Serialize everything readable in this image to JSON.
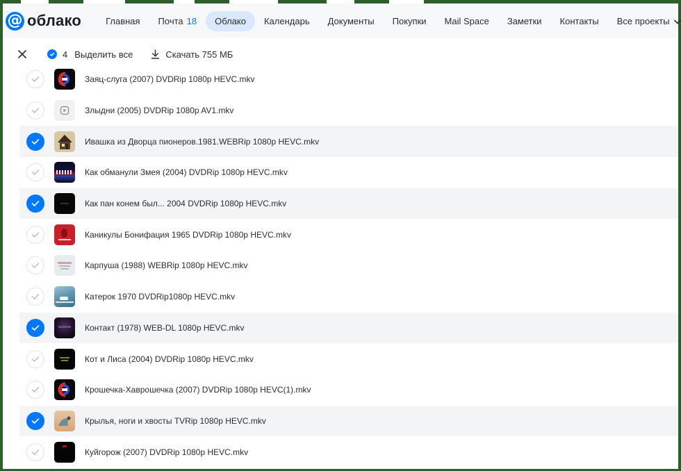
{
  "logo": {
    "text": "облако"
  },
  "nav": {
    "items": [
      {
        "label": "Главная"
      },
      {
        "label": "Почта",
        "badge": "18"
      },
      {
        "label": "Облако",
        "active": true
      },
      {
        "label": "Календарь"
      },
      {
        "label": "Документы"
      },
      {
        "label": "Покупки"
      },
      {
        "label": "Mail Space"
      },
      {
        "label": "Заметки"
      },
      {
        "label": "Контакты"
      },
      {
        "label": "Все проекты",
        "dropdown": true
      }
    ]
  },
  "toolbar": {
    "selected_count": "4",
    "select_all_label": "Выделить все",
    "download_label": "Скачать 755 МБ"
  },
  "colors": {
    "accent": "#0077ff",
    "active_tab_bg": "#d9e8fb",
    "selected_row_bg": "#f3f4f6"
  },
  "files": [
    {
      "name": "Заяц-слуга (2007) DVDRip 1080p HEVC.mkv",
      "selected": false,
      "thumb": "logo-red-blue"
    },
    {
      "name": "Злыдни (2005) DVDRip 1080p AV1.mkv",
      "selected": false,
      "thumb": "video-placeholder-icon"
    },
    {
      "name": "Ивашка из Дворца пионеров.1981.WEBRip 1080p HEVC.mkv",
      "selected": true,
      "thumb": "house-drawing"
    },
    {
      "name": "Как обманули Змея (2004) DVDRip 1080p HEVC.mkv",
      "selected": false,
      "thumb": "dark-red-blue"
    },
    {
      "name": "Как пан конем был... 2004 DVDRip 1080p HEVC.mkv",
      "selected": true,
      "thumb": "black"
    },
    {
      "name": "Каникулы Бонифация 1965 DVDRip 1080p HEVC.mkv",
      "selected": false,
      "thumb": "red"
    },
    {
      "name": "Карпуша (1988) WEBRip 1080p HEVC.mkv",
      "selected": false,
      "thumb": "pale-title"
    },
    {
      "name": "Катерок 1970 DVDRip1080p HEVC.mkv",
      "selected": false,
      "thumb": "blue-water"
    },
    {
      "name": "Контакт (1978) WEB-DL 1080p HEVC.mkv",
      "selected": true,
      "thumb": "dark-purple"
    },
    {
      "name": "Кот и Лиса (2004) DVDRip 1080p HEVC.mkv",
      "selected": false,
      "thumb": "black-green-text"
    },
    {
      "name": "Крошечка-Хаврошечка (2007) DVDRip 1080p HEVC(1).mkv",
      "selected": false,
      "thumb": "logo-red-blue"
    },
    {
      "name": "Крылья, ноги и хвосты TVRip 1080p HEVC.mkv",
      "selected": true,
      "thumb": "bird-sand"
    },
    {
      "name": "Куйгорож (2007) DVDRip 1080p HEVC.mkv",
      "selected": false,
      "thumb": "black-red"
    }
  ]
}
